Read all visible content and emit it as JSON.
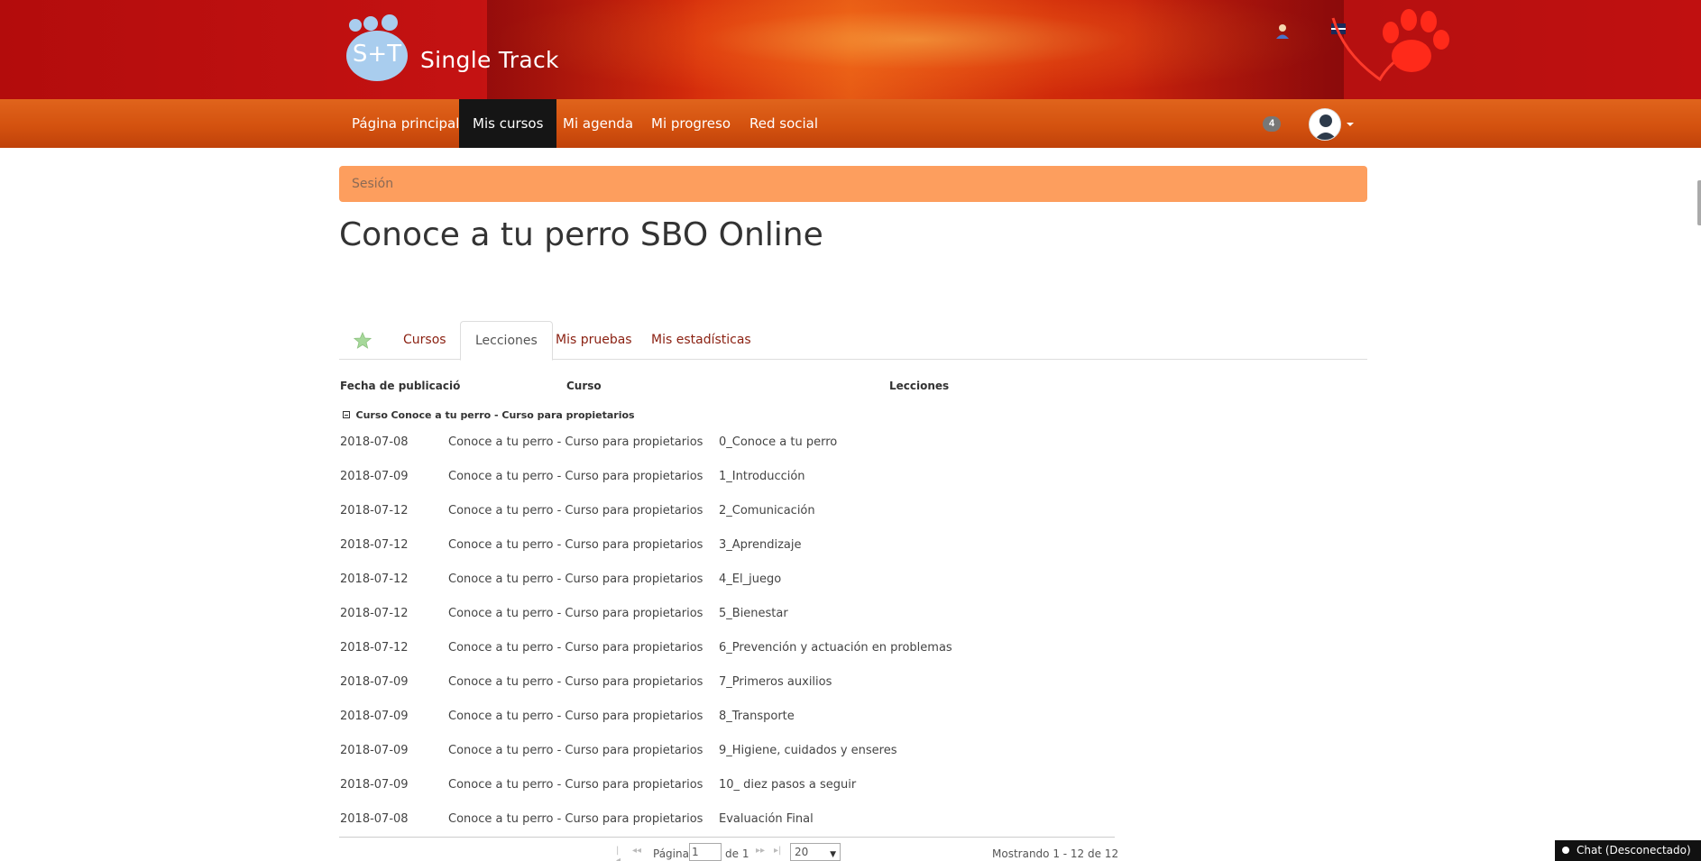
{
  "banner": {
    "logo_text": "Single Track",
    "logo_letters": "S+T"
  },
  "nav": {
    "items": [
      {
        "label": "Página principal"
      },
      {
        "label": "Mis cursos",
        "active": true
      },
      {
        "label": "Mi agenda"
      },
      {
        "label": "Mi progreso"
      },
      {
        "label": "Red social"
      }
    ],
    "notification_count": "4"
  },
  "breadcrumb": "Sesión",
  "page_title": "Conoce a tu perro SBO Online",
  "tabs": [
    {
      "label": "Cursos"
    },
    {
      "label": "Lecciones",
      "active": true
    },
    {
      "label": "Mis pruebas"
    },
    {
      "label": "Mis estadísticas"
    }
  ],
  "table": {
    "headers": [
      "Fecha de publicació",
      "Curso",
      "Lecciones"
    ],
    "group": {
      "prefix": "Curso",
      "name": "Conoce a tu perro - Curso para propietarios"
    },
    "rows": [
      {
        "date": "2018-07-08",
        "course": "Conoce a tu perro - Curso para propietarios",
        "lesson": "0_Conoce a tu perro"
      },
      {
        "date": "2018-07-09",
        "course": "Conoce a tu perro - Curso para propietarios",
        "lesson": "1_Introducción"
      },
      {
        "date": "2018-07-12",
        "course": "Conoce a tu perro - Curso para propietarios",
        "lesson": "2_Comunicación"
      },
      {
        "date": "2018-07-12",
        "course": "Conoce a tu perro - Curso para propietarios",
        "lesson": "3_Aprendizaje"
      },
      {
        "date": "2018-07-12",
        "course": "Conoce a tu perro - Curso para propietarios",
        "lesson": "4_El_juego"
      },
      {
        "date": "2018-07-12",
        "course": "Conoce a tu perro - Curso para propietarios",
        "lesson": "5_Bienestar"
      },
      {
        "date": "2018-07-12",
        "course": "Conoce a tu perro - Curso para propietarios",
        "lesson": "6_Prevención y actuación en problemas"
      },
      {
        "date": "2018-07-09",
        "course": "Conoce a tu perro - Curso para propietarios",
        "lesson": "7_Primeros auxilios"
      },
      {
        "date": "2018-07-09",
        "course": "Conoce a tu perro - Curso para propietarios",
        "lesson": "8_Transporte"
      },
      {
        "date": "2018-07-09",
        "course": "Conoce a tu perro - Curso para propietarios",
        "lesson": "9_Higiene, cuidados y enseres"
      },
      {
        "date": "2018-07-09",
        "course": "Conoce a tu perro - Curso para propietarios",
        "lesson": "10_ diez pasos a seguir"
      },
      {
        "date": "2018-07-08",
        "course": "Conoce a tu perro - Curso para propietarios",
        "lesson": "Evaluación Final"
      }
    ]
  },
  "pager": {
    "page_label": "Página",
    "page_value": "1",
    "of_label": "de 1",
    "page_size": "20",
    "info": "Mostrando 1 - 12 de 12"
  },
  "chat": {
    "label": "Chat (Desconectado)"
  },
  "colors": {
    "banner_red": "#c41212",
    "nav_orange": "#d4520f",
    "breadcrumb_bg": "#fd9e5e",
    "tab_link": "#8a1f10",
    "active_nav": "#151515"
  }
}
